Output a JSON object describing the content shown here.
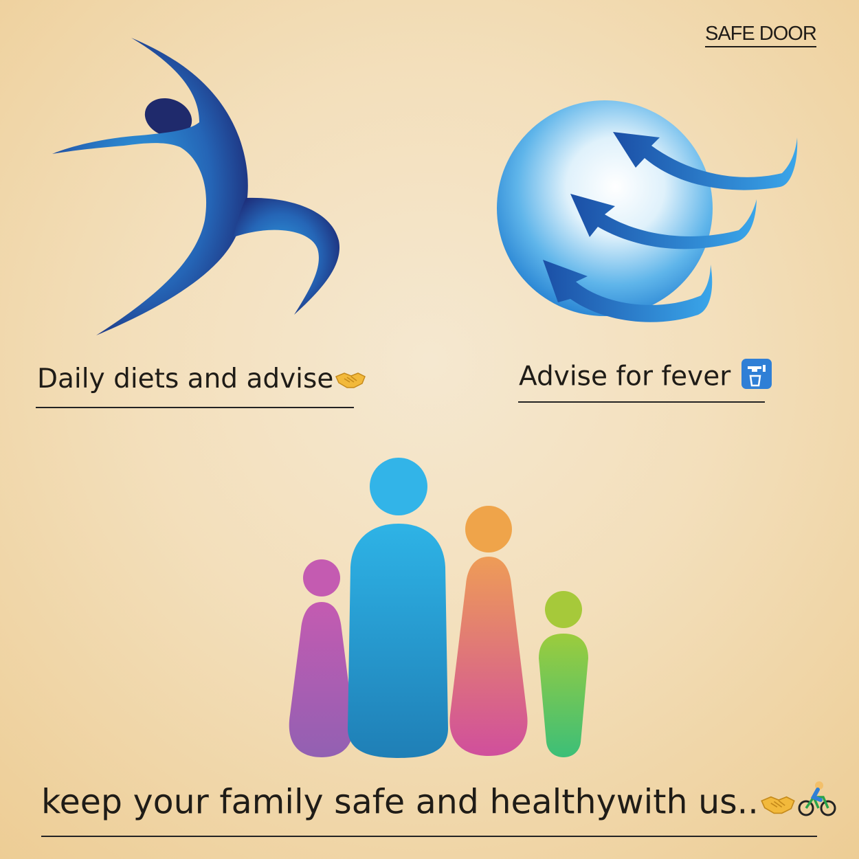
{
  "brand": {
    "name": "SAFE DOOR"
  },
  "features": [
    {
      "caption": "Daily diets and advise",
      "emoji": "handshake-icon"
    },
    {
      "caption": "Advise for fever ",
      "emoji": "potable-water-icon"
    }
  ],
  "footer": {
    "tagline": "keep your family safe and healthywith us..",
    "emojis": [
      "handshake-icon",
      "bicyclist-icon"
    ]
  },
  "colors": {
    "background": "#f3dfbb",
    "figure_blue": "#1f3f8f",
    "globe_blue": "#2a86d4",
    "family_purple": "#9a5fb0",
    "family_blue": "#2b9ad0",
    "family_orange": "#f0a447",
    "family_green": "#4fc27a",
    "text": "#1f1c17"
  }
}
